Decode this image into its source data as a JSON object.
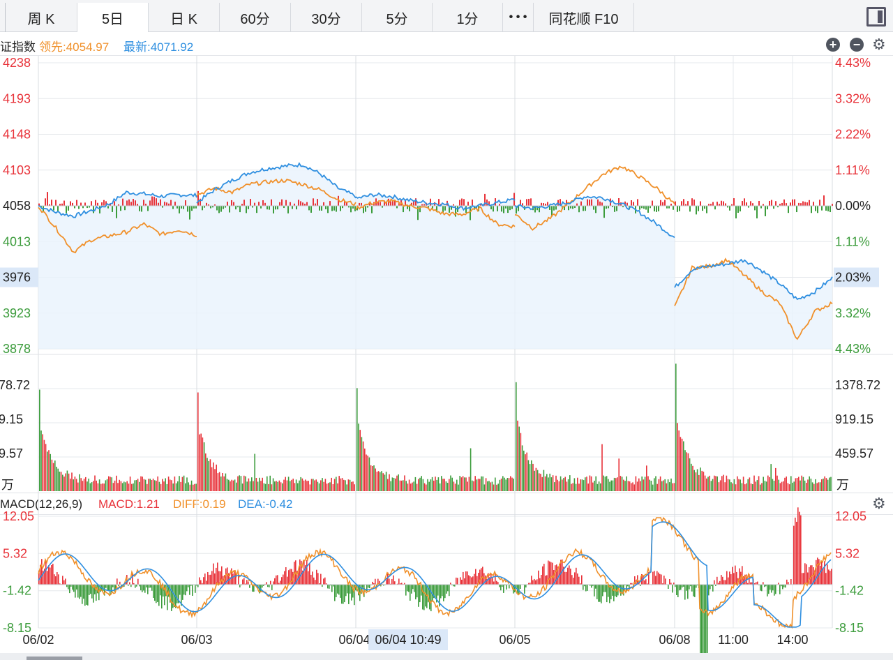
{
  "toolbar": {
    "tabs": [
      {
        "label": "周 K"
      },
      {
        "label": "5日"
      },
      {
        "label": "日 K"
      },
      {
        "label": "60分"
      },
      {
        "label": "30分"
      },
      {
        "label": "5分"
      },
      {
        "label": "1分"
      },
      {
        "label": "• • •"
      },
      {
        "label": "同花顺 F10"
      }
    ],
    "active_tab": "5日"
  },
  "info": {
    "index_name": "证指数",
    "lead_label": "领先:4054.97",
    "latest_label": "最新:4071.92"
  },
  "macd_info": {
    "name": "MACD(12,26,9)",
    "macd": "MACD:1.21",
    "diff": "DIFF:0.19",
    "dea": "DEA:-0.42"
  },
  "cursor": {
    "time": "06/04 10:49"
  },
  "colors": {
    "up": "#e8333a",
    "down": "#3c9c3c",
    "latest": "#2f8fe0",
    "lead": "#f0902a",
    "grid": "#e6e8ec",
    "fill": "#e8f3fc"
  },
  "chart_data": [
    {
      "type": "line",
      "title": "",
      "baseline": 4058,
      "ylim": [
        3878,
        4238
      ],
      "y_ticks_left": [
        "4238",
        "4193",
        "4148",
        "4103",
        "4058",
        "4013",
        "3976",
        "3923",
        "3878"
      ],
      "y_ticks_right": [
        "4.43%",
        "3.32%",
        "2.22%",
        "1.11%",
        "0.00%",
        "1.11%",
        "2.03%",
        "3.32%",
        "4.43%"
      ],
      "highlight_tick": {
        "left": "3976",
        "right": "2.03%"
      },
      "x_labels": [
        "06/02",
        "06/03",
        "06/04",
        "06/05",
        "06/08",
        "11:00",
        "14:00"
      ],
      "series": [
        {
          "name": "最新",
          "color": "#2f8fe0",
          "day_points": [
            [
              4058,
              4050,
              4045,
              4052,
              4060,
              4075,
              4073,
              4070,
              4072,
              4071
            ],
            [
              4062,
              4078,
              4090,
              4100,
              4105,
              4108,
              4110,
              4098,
              4080,
              4070
            ],
            [
              4067,
              4072,
              4070,
              4065,
              4062,
              4060,
              4055,
              4058,
              4062,
              4066
            ],
            [
              4058,
              4055,
              4058,
              4062,
              4070,
              4068,
              4060,
              4050,
              4035,
              4018
            ],
            [
              3955,
              3978,
              3982,
              3985,
              3990,
              3976,
              3960,
              3940,
              3950,
              3967
            ]
          ]
        },
        {
          "name": "领先",
          "color": "#f0902a",
          "day_points": [
            [
              4058,
              4030,
              4000,
              4015,
              4020,
              4025,
              4035,
              4022,
              4028,
              4021
            ],
            [
              4072,
              4080,
              4075,
              4085,
              4088,
              4090,
              4085,
              4078,
              4066,
              4060
            ],
            [
              4055,
              4062,
              4064,
              4058,
              4055,
              4048,
              4047,
              4055,
              4035,
              4032
            ],
            [
              4048,
              4030,
              4042,
              4060,
              4080,
              4098,
              4108,
              4095,
              4080,
              4060
            ],
            [
              3930,
              3980,
              3982,
              3990,
              3970,
              3950,
              3935,
              3890,
              3925,
              3936
            ]
          ]
        }
      ]
    },
    {
      "type": "bar",
      "title": "",
      "unit": "万",
      "y_ticks": [
        "1378.72",
        "919.15",
        "459.57"
      ],
      "day_volume_profile": [
        1378.72,
        1378.72,
        1378.72,
        1378.72,
        1378.72
      ],
      "spike_values": [
        1378.72,
        1340,
        1450,
        1500,
        1650
      ],
      "base_value": 140
    },
    {
      "type": "bar",
      "title": "",
      "y_ticks_left": [
        "12.05",
        "5.32",
        "-1.42",
        "-8.15"
      ],
      "y_ticks_right": [
        "12.05",
        "5.32",
        "-1.42",
        "-8.15"
      ],
      "ylim": [
        -8.15,
        12.05
      ],
      "series": [
        {
          "name": "DIFF",
          "color": "#f0902a"
        },
        {
          "name": "DEA",
          "color": "#2f8fe0"
        }
      ],
      "current": {
        "MACD": 1.21,
        "DIFF": 0.19,
        "DEA": -0.42
      }
    }
  ]
}
